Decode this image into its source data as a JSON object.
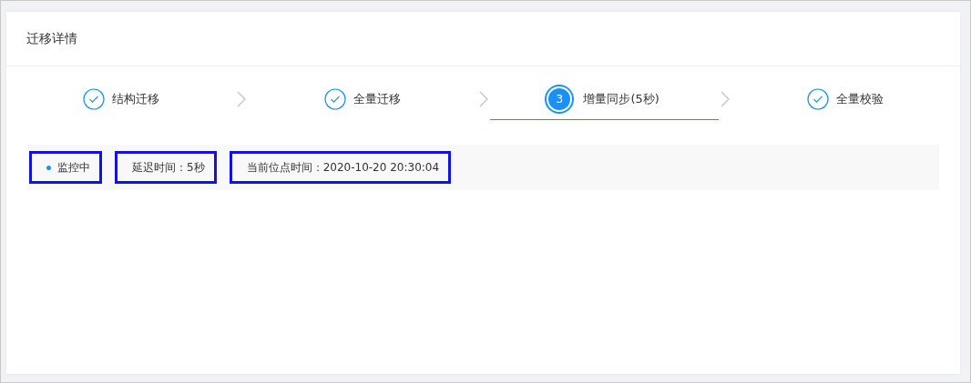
{
  "card": {
    "title": "迁移详情"
  },
  "steps": [
    {
      "label": "结构迁移",
      "kind": "finished",
      "selected": false
    },
    {
      "label": "全量迁移",
      "kind": "finished",
      "selected": false
    },
    {
      "label": "增量同步(5秒)",
      "kind": "active",
      "number": "3",
      "selected": true
    },
    {
      "label": "全量校验",
      "kind": "finished",
      "selected": false
    }
  ],
  "info": [
    {
      "kind": "status",
      "text": "监控中",
      "color": "#1890ff",
      "highlighted": true
    },
    {
      "kind": "text",
      "text": "延迟时间：5秒",
      "highlighted": true
    },
    {
      "kind": "text",
      "text": "当前位点时间：2020-10-20 20:30:04",
      "highlighted": true
    }
  ]
}
